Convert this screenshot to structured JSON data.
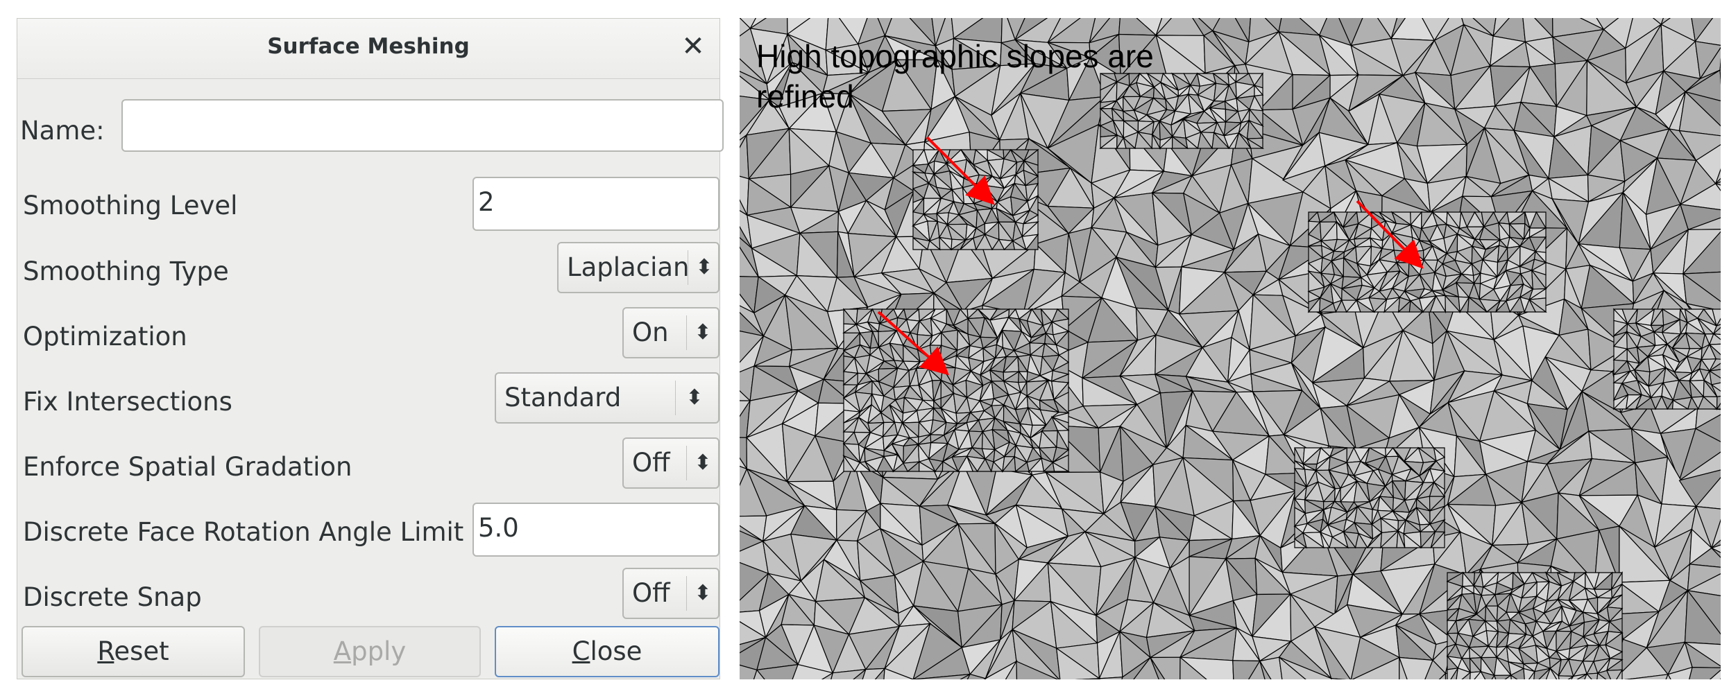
{
  "dialog": {
    "title": "Surface Meshing",
    "close_glyph": "✕",
    "name_label": "Name:",
    "name_value": "",
    "fields": {
      "smoothing_level": {
        "label": "Smoothing Level",
        "value": "2"
      },
      "smoothing_type": {
        "label": "Smoothing Type",
        "value": "Laplacian"
      },
      "optimization": {
        "label": "Optimization",
        "value": "On"
      },
      "fix_intersections": {
        "label": "Fix Intersections",
        "value": "Standard"
      },
      "enforce_spatial_gradation": {
        "label": "Enforce Spatial Gradation",
        "value": "Off"
      },
      "discrete_face_rotation": {
        "label": "Discrete Face Rotation Angle Limit",
        "value": "5.0"
      },
      "discrete_snap": {
        "label": "Discrete Snap",
        "value": "Off"
      }
    },
    "combo_arrow": "⬍",
    "buttons": {
      "reset_mnemonic": "R",
      "reset_rest": "eset",
      "apply_mnemonic": "A",
      "apply_rest": "pply",
      "close_mnemonic": "C",
      "close_rest": "lose"
    }
  },
  "annotation": {
    "caption": "High topographic slopes are refined",
    "arrow_color": "#ff0000"
  },
  "colors": {
    "dialog_bg": "#ededeb",
    "mesh_bg": "#b8b8b8",
    "mesh_edge": "#000000",
    "focus_border": "#5f8dc8"
  }
}
